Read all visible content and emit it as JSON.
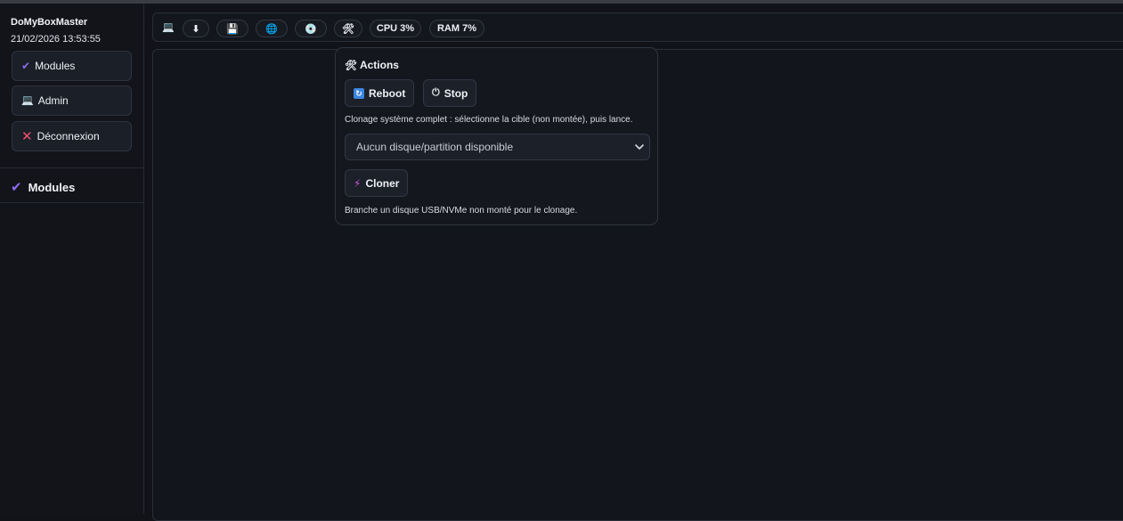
{
  "app": {
    "name": "DoMyBoxMaster",
    "datetime": "21/02/2026 13:53:55"
  },
  "sidebar": {
    "buttons": [
      {
        "label": "Modules",
        "icon": "check-icon"
      },
      {
        "label": "Admin",
        "icon": "computer-icon"
      },
      {
        "label": "Déconnexion",
        "icon": "close-icon"
      }
    ],
    "section": {
      "label": "Modules",
      "icon": "check-icon"
    }
  },
  "topbar": {
    "icons": [
      "computer-icon",
      "download-icon",
      "save-icon",
      "globe-icon",
      "disc-icon",
      "tools-icon"
    ],
    "cpu": "CPU 3%",
    "ram": "RAM 7%"
  },
  "actions_popover": {
    "title": "Actions",
    "reboot_label": "Reboot",
    "stop_label": "Stop",
    "clone_hint": "Clonage système complet : sélectionne la cible (non montée), puis lance.",
    "select_value": "Aucun disque/partition disponible",
    "cloner_label": "Cloner",
    "footer_hint": "Branche un disque USB/NVMe non monté pour le clonage."
  },
  "colors": {
    "background": "#111318",
    "accent_purple": "#8b6cf0",
    "danger_pink": "#f0506e",
    "reboot_blue": "#3b86e0"
  }
}
